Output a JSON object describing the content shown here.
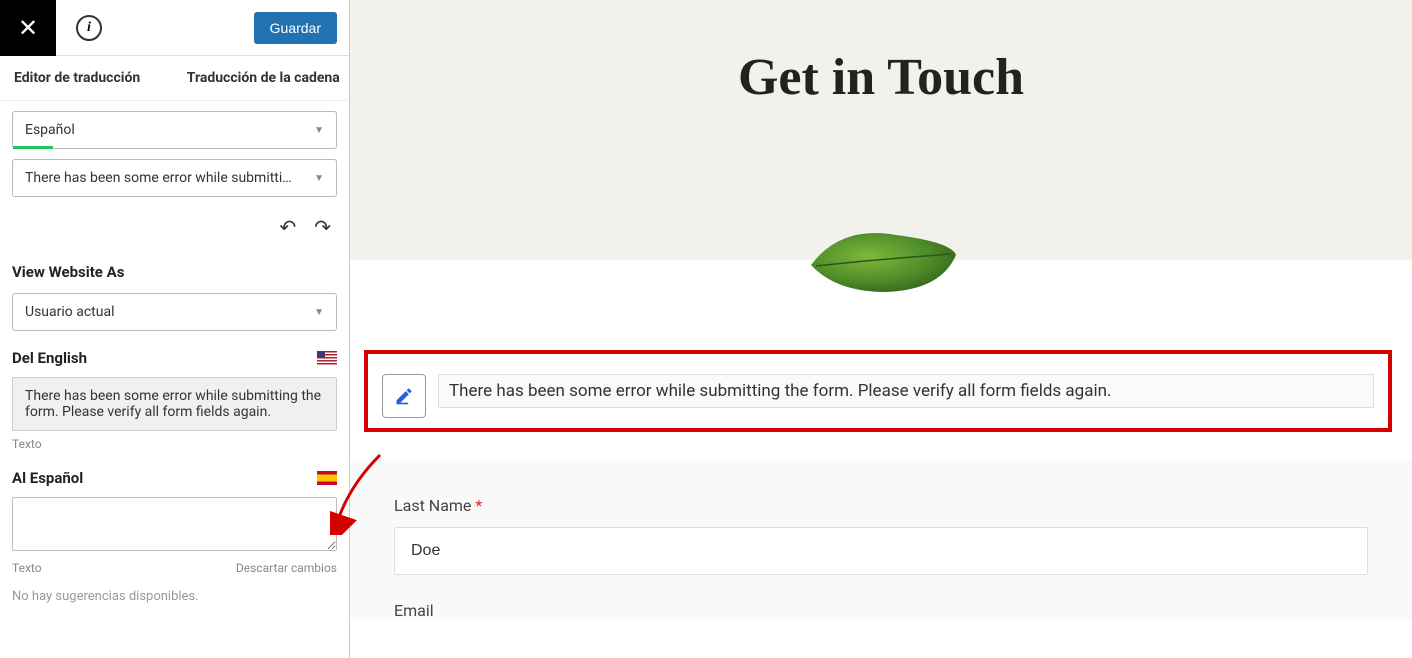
{
  "top": {
    "save_label": "Guardar"
  },
  "tabs": {
    "editor": "Editor de traducción",
    "string": "Traducción de la cadena"
  },
  "language_select": {
    "value": "Español"
  },
  "string_select": {
    "value": "There has been some error while submitting th..."
  },
  "view_as": {
    "label": "View Website As",
    "value": "Usuario actual"
  },
  "source": {
    "label": "Del English",
    "text": "There has been some error while submitting the form. Please verify all form fields again.",
    "type": "Texto"
  },
  "target": {
    "label": "Al Español",
    "text": "",
    "type": "Texto",
    "discard": "Descartar cambios"
  },
  "suggestions": "No hay sugerencias disponibles.",
  "preview": {
    "hero_title": "Get in Touch",
    "error_message": "There has been some error while submitting the form. Please verify all form fields again.",
    "form": {
      "last_name_label": "Last Name",
      "last_name_value": "Doe",
      "email_label": "Email"
    }
  }
}
